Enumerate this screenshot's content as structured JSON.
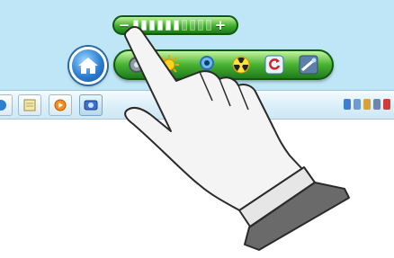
{
  "volume_control": {
    "minus_label": "−",
    "plus_label": "+",
    "level": 0.6,
    "segments_total": 10
  },
  "dock": {
    "home_icon": "home-icon",
    "apps": [
      "settings-icon",
      "sun-icon",
      "camera-icon",
      "radiation-icon",
      "refresh-icon",
      "network-icon"
    ]
  },
  "taskbar": {
    "buttons": [
      "start-orb",
      "notepad-icon",
      "media-player-icon",
      "screenshot-app-icon"
    ],
    "tray_icons": [
      "network-tray-icon",
      "display-tray-icon",
      "shield-tray-icon",
      "speaker-tray-icon",
      "flag-tray-icon"
    ]
  },
  "colors": {
    "dock_green": "#3fae2d",
    "desktop": "#bfe6f6",
    "hand_fill": "#f4f4f4",
    "cuff_dark": "#6a6a6a"
  }
}
